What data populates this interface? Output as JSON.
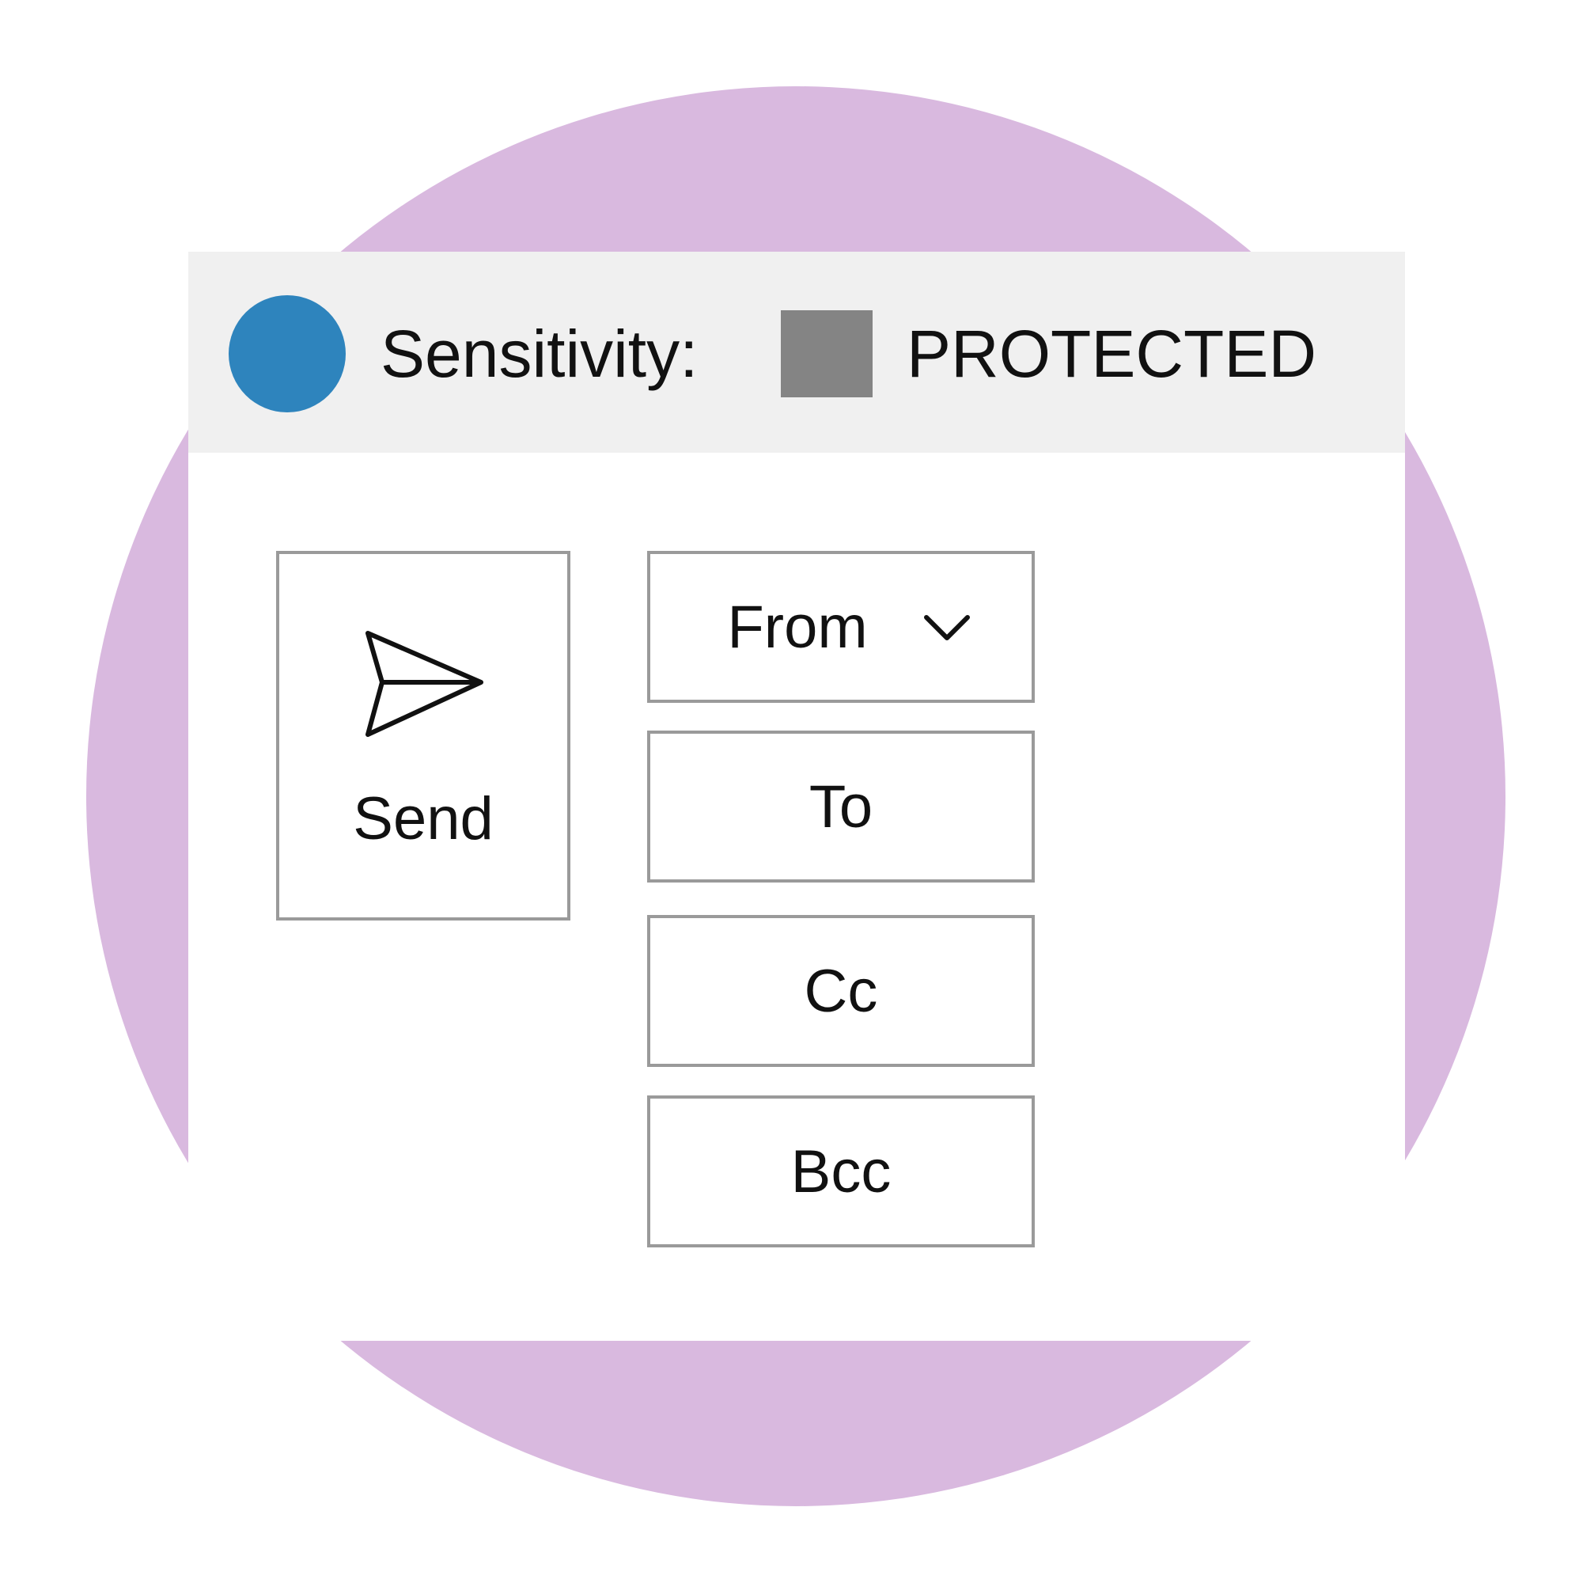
{
  "banner": {
    "sensitivity_label": "Sensitivity:",
    "level": "PROTECTED",
    "status_dot_color": "#2e84bd",
    "swatch_color": "#848484"
  },
  "send_button": {
    "label": "Send",
    "icon": "send-icon"
  },
  "fields": {
    "from": "From",
    "to": "To",
    "cc": "Cc",
    "bcc": "Bcc"
  },
  "background_color": "#d9b9df"
}
